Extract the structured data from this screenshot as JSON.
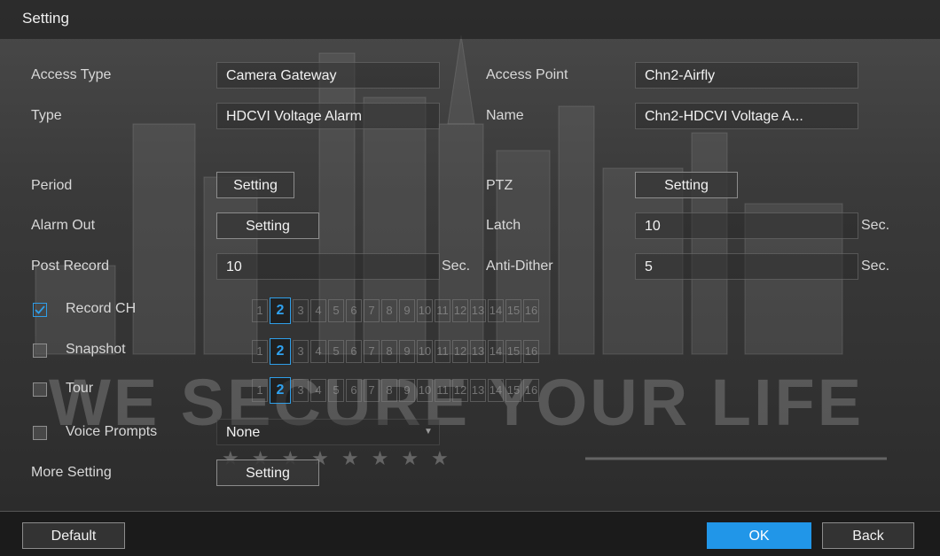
{
  "window": {
    "title": "Setting"
  },
  "background": {
    "slogan": "WE SECURE YOUR LIFE",
    "stars": "★★★★★★★★"
  },
  "access_type": {
    "label": "Access Type",
    "value": "Camera Gateway"
  },
  "access_point": {
    "label": "Access Point",
    "value": "Chn2-Airfly"
  },
  "type": {
    "label": "Type",
    "value": "HDCVI Voltage Alarm"
  },
  "name": {
    "label": "Name",
    "value": "Chn2-HDCVI Voltage A..."
  },
  "period": {
    "label": "Period",
    "button": "Setting"
  },
  "ptz": {
    "label": "PTZ",
    "button": "Setting"
  },
  "alarm_out": {
    "label": "Alarm Out",
    "button": "Setting"
  },
  "latch": {
    "label": "Latch",
    "value": "10",
    "unit": "Sec."
  },
  "post_record": {
    "label": "Post Record",
    "value": "10",
    "unit": "Sec."
  },
  "anti_dither": {
    "label": "Anti-Dither",
    "value": "5",
    "unit": "Sec."
  },
  "record_ch": {
    "label": "Record CH",
    "checked": true,
    "selected": "2",
    "channels": [
      "1",
      "2",
      "3",
      "4",
      "5",
      "6",
      "7",
      "8",
      "9",
      "10",
      "11",
      "12",
      "13",
      "14",
      "15",
      "16"
    ]
  },
  "snapshot": {
    "label": "Snapshot",
    "checked": false,
    "selected": "2",
    "channels": [
      "1",
      "2",
      "3",
      "4",
      "5",
      "6",
      "7",
      "8",
      "9",
      "10",
      "11",
      "12",
      "13",
      "14",
      "15",
      "16"
    ]
  },
  "tour": {
    "label": "Tour",
    "checked": false,
    "selected": "2",
    "channels": [
      "1",
      "2",
      "3",
      "4",
      "5",
      "6",
      "7",
      "8",
      "9",
      "10",
      "11",
      "12",
      "13",
      "14",
      "15",
      "16"
    ]
  },
  "voice_prompts": {
    "label": "Voice Prompts",
    "checked": false,
    "value": "None"
  },
  "more_setting": {
    "label": "More Setting",
    "button": "Setting"
  },
  "footer": {
    "default": "Default",
    "ok": "OK",
    "back": "Back"
  },
  "colors": {
    "accent": "#2196e8",
    "selected_channel": "#2fa2f0"
  },
  "icons": {
    "check": "checkmark-icon",
    "dropdown": "chevron-down-icon"
  }
}
